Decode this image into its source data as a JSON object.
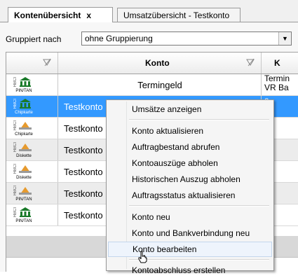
{
  "tabs": [
    {
      "label": "Kontenübersicht",
      "close": "x"
    },
    {
      "label": "Umsatzübersicht - Testkonto"
    }
  ],
  "grouping": {
    "label": "Gruppiert nach",
    "value": "ohne Gruppierung"
  },
  "columns": {
    "konto": "Konto",
    "next": "K"
  },
  "rows": [
    {
      "type_badge": "PIN/TAN",
      "icon": "bank-icon",
      "konto": "Termingeld",
      "rest1": "Termin",
      "rest2": "VR Ba"
    },
    {
      "type_badge": "Chipkarte",
      "icon": "bank-icon",
      "konto": "Testkonto",
      "rest1": "",
      "rest2": "a"
    },
    {
      "type_badge": "Chipkarte",
      "icon": "chipcard-icon",
      "konto": "Testkonto",
      "rest1": "o",
      "rest2": "sl"
    },
    {
      "type_badge": "Diskette",
      "icon": "disk-icon",
      "konto": "Testkonto",
      "rest1": "o",
      "rest2": "sl"
    },
    {
      "type_badge": "Diskette",
      "icon": "disk-icon",
      "konto": "Testkonto",
      "rest1": "o",
      "rest2": "a"
    },
    {
      "type_badge": "PIN/TAN",
      "icon": "disk-icon",
      "konto": "Testkonto",
      "rest1": "o",
      "rest2": "a"
    },
    {
      "type_badge": "PIN/TAN",
      "icon": "bank-icon",
      "konto": "Testkonto",
      "rest1": "o",
      "rest2": "a"
    }
  ],
  "context_menu": {
    "items": [
      "Umsätze anzeigen",
      "Konto aktualisieren",
      "Auftragbestand abrufen",
      "Kontoauszüge abholen",
      "Historischen Auszug abholen",
      "Auftragsstatus aktualisieren",
      "Konto neu",
      "Konto und Bankverbindung neu",
      "Konto bearbeiten",
      "Kontoabschluss erstellen"
    ],
    "hot_item": "Konto bearbeiten"
  },
  "colors": {
    "selection": "#3399ff",
    "bank_green": "#1a7a2a",
    "card_orange": "#e69a2e"
  }
}
